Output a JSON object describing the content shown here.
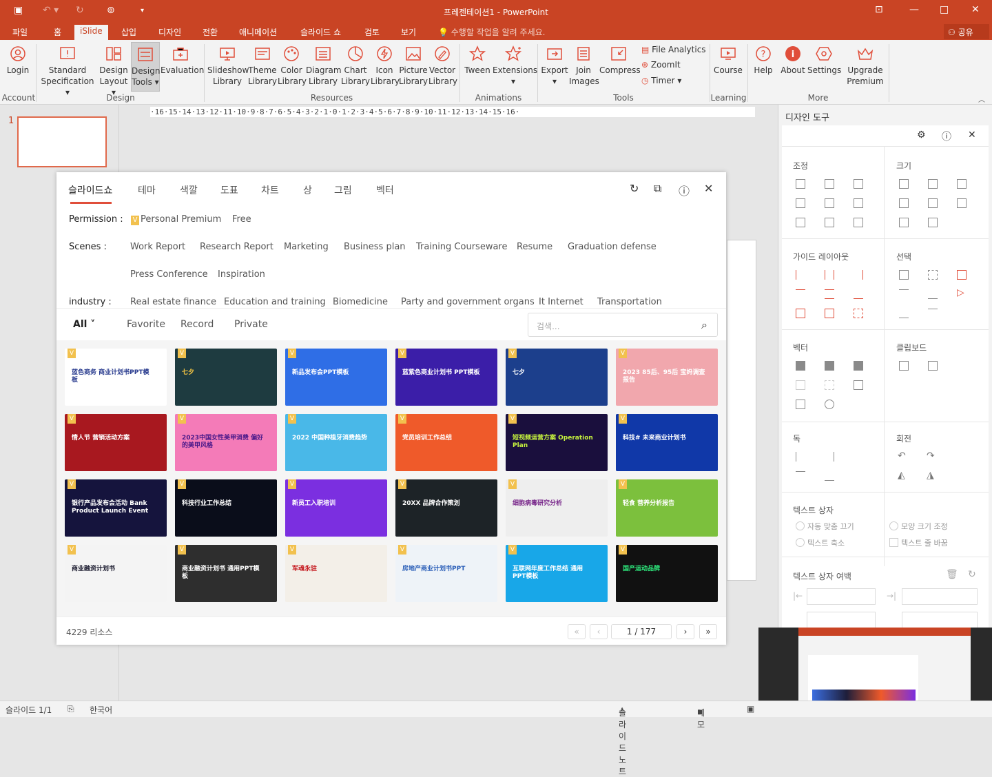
{
  "window": {
    "title": "프레젠테이션1 - PowerPoint"
  },
  "ribbon_tabs": [
    "파일",
    "홈",
    "iSlide",
    "삽입",
    "디자인",
    "전환",
    "애니메이션",
    "슬라이드 쇼",
    "검토",
    "보기"
  ],
  "tell_me": "수행할 작업을 알려 주세요.",
  "share": "공유",
  "ribbon": {
    "buttons": [
      {
        "label": "Login",
        "sub": ""
      },
      {
        "label": "Standard",
        "sub": "Specification ▾"
      },
      {
        "label": "Design",
        "sub": "Layout ▾"
      },
      {
        "label": "Design",
        "sub": "Tools ▾"
      },
      {
        "label": "Evaluation",
        "sub": ""
      },
      {
        "label": "Slideshow",
        "sub": "Library"
      },
      {
        "label": "Theme",
        "sub": "Library"
      },
      {
        "label": "Color",
        "sub": "Library"
      },
      {
        "label": "Diagram",
        "sub": "Library"
      },
      {
        "label": "Chart",
        "sub": "Library"
      },
      {
        "label": "Icon",
        "sub": "Library"
      },
      {
        "label": "Picture",
        "sub": "Library"
      },
      {
        "label": "Vector",
        "sub": "Library"
      },
      {
        "label": "Tween",
        "sub": ""
      },
      {
        "label": "Extensions",
        "sub": "▾"
      },
      {
        "label": "Export",
        "sub": "▾"
      },
      {
        "label": "Join",
        "sub": "Images"
      },
      {
        "label": "Compress",
        "sub": ""
      },
      {
        "label": "Course",
        "sub": ""
      },
      {
        "label": "Help",
        "sub": ""
      },
      {
        "label": "About",
        "sub": ""
      },
      {
        "label": "Settings",
        "sub": ""
      },
      {
        "label": "Upgrade",
        "sub": "Premium"
      }
    ],
    "small": [
      "File Analytics",
      "ZoomIt",
      "Timer  ▾"
    ],
    "groups": [
      "Account",
      "Design",
      "Resources",
      "Animations",
      "Tools",
      "Learning",
      "More"
    ]
  },
  "ruler": "·16·15·14·13·12·11·10·9·8·7·6·5·4·3·2·1·0·1·2·3·4·5·6·7·8·9·10·11·12·13·14·15·16·",
  "thumb_number": "1",
  "dialog": {
    "tabs": [
      "슬라이드쇼",
      "테마",
      "색깔",
      "도표",
      "차트",
      "상",
      "그림",
      "벡터"
    ],
    "permission_label": "Permission :",
    "permission": [
      "Personal Premium",
      "Free"
    ],
    "scenes_label": "Scenes :",
    "scenes": [
      "Work Report",
      "Research Report",
      "Marketing",
      "Business plan",
      "Training Courseware",
      "Resume",
      "Graduation defense",
      "Press Conference",
      "Inspiration"
    ],
    "industry_label": "industry :",
    "industry": [
      "Real estate finance",
      "Education and training",
      "Biomedicine",
      "Party and government organs",
      "It Internet",
      "Transportation"
    ],
    "filters": [
      "All",
      "Favorite",
      "Record",
      "Private"
    ],
    "search_placeholder": "검색...",
    "cards": [
      {
        "title": "蓝色商务 商业计划书PPT模板",
        "bg": "#ffffff",
        "fg": "#2a3c8f"
      },
      {
        "title": "七夕",
        "bg": "#1e3b40",
        "fg": "#f4c542"
      },
      {
        "title": "新品发布会PPT模板",
        "bg": "#2f6ee6",
        "fg": "#ffffff"
      },
      {
        "title": "蓝紫色商业计划书 PPT模板",
        "bg": "#3b1ea8",
        "fg": "#ffffff"
      },
      {
        "title": "七夕",
        "bg": "#1c3f8c",
        "fg": "#ffffff"
      },
      {
        "title": "2023 85后、95后 宝妈调查报告",
        "bg": "#f1a7ad",
        "fg": "#ffffff"
      },
      {
        "title": "情人节 营销活动方案",
        "bg": "#a8181f",
        "fg": "#ffffff"
      },
      {
        "title": "2023中国女性美甲消费 偏好的美甲风格",
        "bg": "#f47bb8",
        "fg": "#4b1a8a"
      },
      {
        "title": "2022 中国种植牙消费趋势",
        "bg": "#49b8e8",
        "fg": "#ffffff"
      },
      {
        "title": "党员培训工作总结",
        "bg": "#ef5a2a",
        "fg": "#ffffff"
      },
      {
        "title": "短视频运营方案 Operation Plan",
        "bg": "#1a0f3d",
        "fg": "#c6f23e"
      },
      {
        "title": "科技# 未来商业计划书",
        "bg": "#1038a8",
        "fg": "#ffffff"
      },
      {
        "title": "银行产品发布会活动 Bank Product Launch Event",
        "bg": "#15143d",
        "fg": "#ffffff"
      },
      {
        "title": "科技行业工作总结",
        "bg": "#0a0d1a",
        "fg": "#ffffff"
      },
      {
        "title": "新员工入职培训",
        "bg": "#7b2fe0",
        "fg": "#ffffff"
      },
      {
        "title": "20XX 品牌合作策划",
        "bg": "#1d2327",
        "fg": "#ffffff"
      },
      {
        "title": "细胞病毒研究分析",
        "bg": "#eeeeee",
        "fg": "#7a2a8c"
      },
      {
        "title": "轻食 营养分析报告",
        "bg": "#7cc03d",
        "fg": "#ffffff"
      },
      {
        "title": "商业融资计划书",
        "bg": "#f4f4f4",
        "fg": "#1a1a2e"
      },
      {
        "title": "商业融资计划书 通用PPT模板",
        "bg": "#2e2e2e",
        "fg": "#ffffff"
      },
      {
        "title": "军魂永驻",
        "bg": "#f3efe8",
        "fg": "#c4161c"
      },
      {
        "title": "房地产商业计划书PPT",
        "bg": "#eef3f8",
        "fg": "#2b5fb8"
      },
      {
        "title": "互联网年度工作总结 通用PPT模板",
        "bg": "#18a7e8",
        "fg": "#ffffff"
      },
      {
        "title": "国产运动品牌",
        "bg": "#111111",
        "fg": "#2ee87c"
      }
    ],
    "count": "4229 리소스",
    "page": "1 / 177"
  },
  "panel": {
    "title": "디자인 도구",
    "sections": [
      "조정",
      "크기",
      "가이드 레이아웃",
      "선택",
      "벡터",
      "클립보드",
      "독",
      "회전",
      "텍스트 상자",
      "텍스트 상자 여백"
    ],
    "checks": [
      "자동 맞춤 끄기",
      "모양 크기 조정",
      "텍스트 축소",
      "텍스트 줄 바꿈"
    ]
  },
  "status": {
    "slide": "슬라이드 1/1",
    "lang": "한국어",
    "notes": "슬라이드 노트",
    "comments": "메모"
  },
  "colors": {
    "accent": "#c94424",
    "tabline": "#e04e3a"
  }
}
